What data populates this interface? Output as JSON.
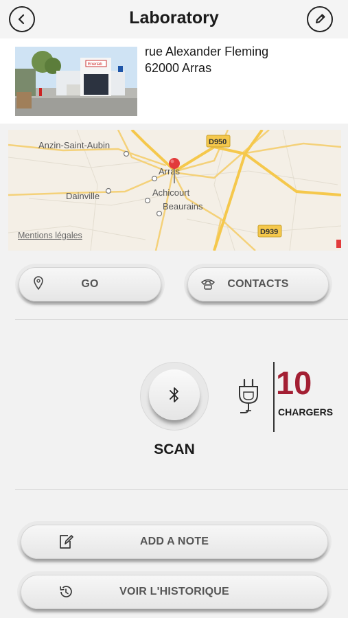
{
  "header": {
    "title": "Laboratory",
    "back_icon": "chevron-left-icon",
    "edit_icon": "pencil-icon"
  },
  "site": {
    "address_line1": "rue Alexander Fleming",
    "address_line2": "62000 Arras",
    "photo_sign": "Enerlab"
  },
  "map": {
    "legal": "Mentions légales",
    "places": [
      "Anzin-Saint-Aubin",
      "Arras",
      "Dainville",
      "Achicourt",
      "Beaurains"
    ],
    "roads": [
      "D950",
      "D939"
    ],
    "road_color": "#f5c84c",
    "marker_color": "#e23b3b"
  },
  "actions": {
    "go_label": "GO",
    "contacts_label": "CONTACTS",
    "scan_label": "SCAN",
    "add_note_label": "ADD A NOTE",
    "history_label": "VOIR L'HISTORIQUE"
  },
  "chargers": {
    "count": "10",
    "label": "CHARGERS",
    "accent_color": "#a31f33"
  }
}
